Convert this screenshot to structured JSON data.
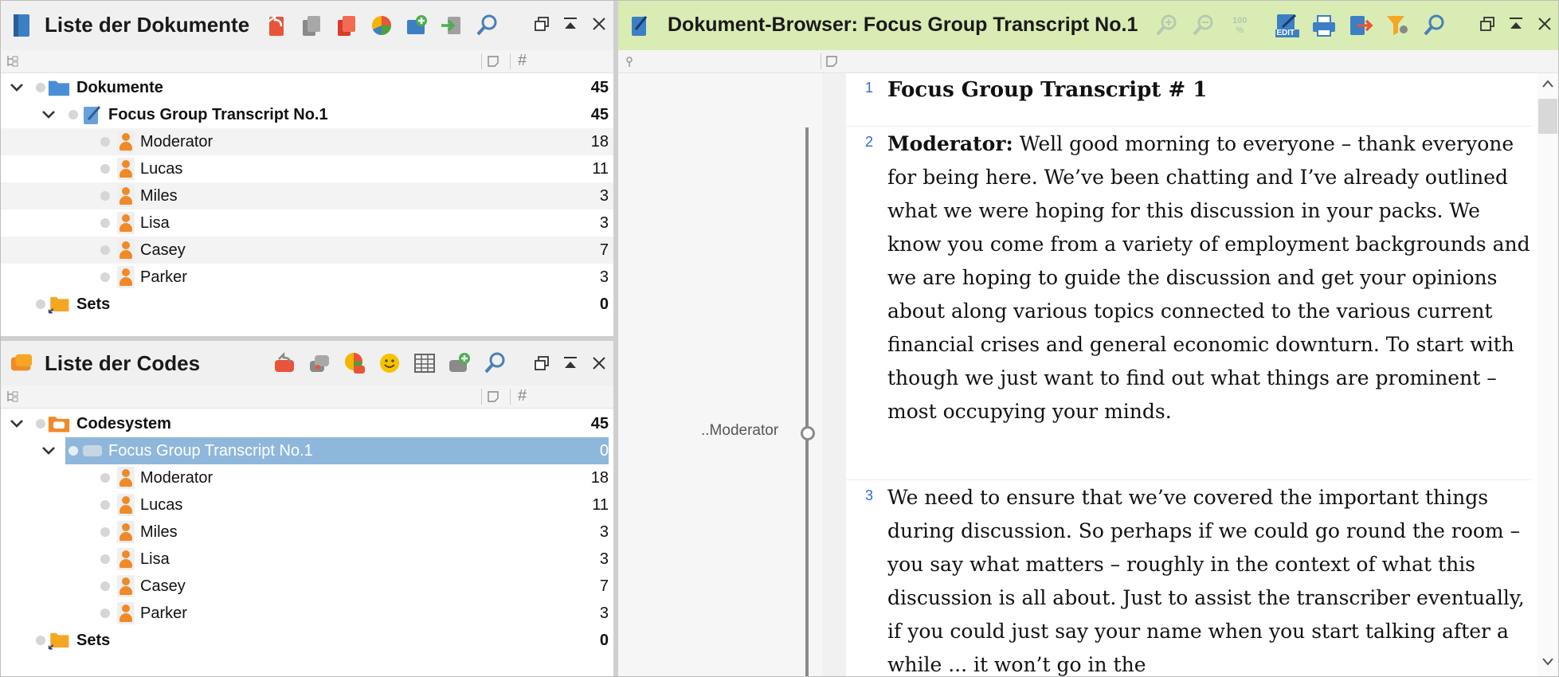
{
  "documents_panel": {
    "title": "Liste der Dokumente",
    "tree": [
      {
        "label": "Dokumente",
        "count": "45"
      },
      {
        "label": "Focus Group Transcript No.1",
        "count": "45"
      },
      {
        "label": "Moderator",
        "count": "18"
      },
      {
        "label": "Lucas",
        "count": "11"
      },
      {
        "label": "Miles",
        "count": "3"
      },
      {
        "label": "Lisa",
        "count": "3"
      },
      {
        "label": "Casey",
        "count": "7"
      },
      {
        "label": "Parker",
        "count": "3"
      },
      {
        "label": "Sets",
        "count": "0"
      }
    ]
  },
  "codes_panel": {
    "title": "Liste der Codes",
    "tree": [
      {
        "label": "Codesystem",
        "count": "45"
      },
      {
        "label": "Focus Group Transcript No.1",
        "count": "0"
      },
      {
        "label": "Moderator",
        "count": "18"
      },
      {
        "label": "Lucas",
        "count": "11"
      },
      {
        "label": "Miles",
        "count": "3"
      },
      {
        "label": "Lisa",
        "count": "3"
      },
      {
        "label": "Casey",
        "count": "7"
      },
      {
        "label": "Parker",
        "count": "3"
      },
      {
        "label": "Sets",
        "count": "0"
      }
    ]
  },
  "browser_panel": {
    "title": "Dokument-Browser: Focus Group Transcript No.1",
    "zoom_badge": "100 %",
    "edit_badge": "EDIT",
    "code_marker": "..Moderator",
    "paragraphs": [
      {
        "num": "1",
        "speaker": "",
        "text": "Focus Group Transcript # 1"
      },
      {
        "num": "2",
        "speaker": "Moderator:",
        "text": "Well good morning to everyone – thank everyone for being here.  We’ve been chatting and I’ve already outlined what we were hoping for this discussion in your packs.  We know you come from a variety of employment backgrounds and we are hoping to guide the discussion and get your opinions about along various topics connected to the various current financial crises and general economic downturn.  To start with though we just want to find out what things are prominent – most occupying your minds."
      },
      {
        "num": "3",
        "speaker": "",
        "text": "We need to ensure that we’ve covered the important things during discussion.  So perhaps if we could go round the room – you say what matters – roughly in the context of what this discussion is all about.  Just to assist the transcriber eventually, if you could just say your name when you start talking after a while ... it won’t go in the"
      }
    ]
  },
  "colors": {
    "documents_titlebar": "#f0f0f0",
    "browser_titlebar": "#d9ecb4",
    "selection": "#8fb7dc",
    "code_person": "#f08a28",
    "line_number": "#2e6bd6"
  }
}
